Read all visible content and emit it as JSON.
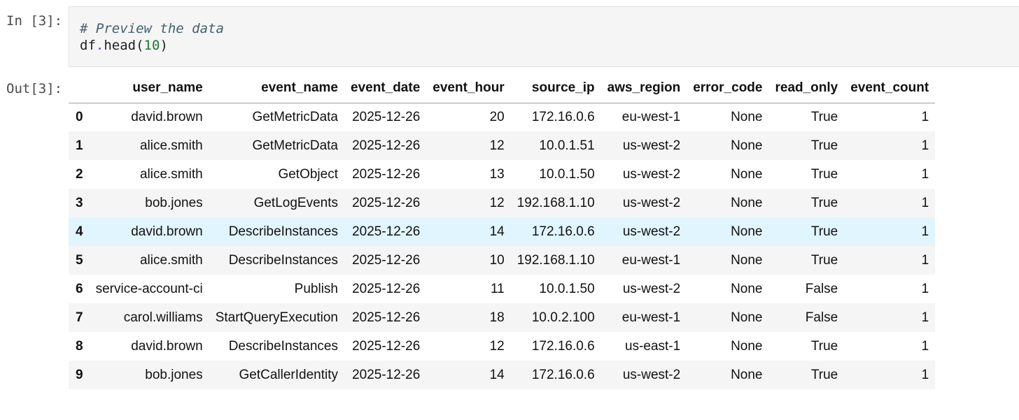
{
  "cell_input": {
    "prompt": "In [3]:",
    "comment": "# Preview the data",
    "code_obj": "df",
    "code_dot": ".",
    "code_method": "head(",
    "code_arg": "10",
    "code_close": ")"
  },
  "cell_output": {
    "prompt": "Out[3]:"
  },
  "table": {
    "columns": [
      "",
      "user_name",
      "event_name",
      "event_date",
      "event_hour",
      "source_ip",
      "aws_region",
      "error_code",
      "read_only",
      "event_count"
    ],
    "rows": [
      [
        "0",
        "david.brown",
        "GetMetricData",
        "2025-12-26",
        "20",
        "172.16.0.6",
        "eu-west-1",
        "None",
        "True",
        "1"
      ],
      [
        "1",
        "alice.smith",
        "GetMetricData",
        "2025-12-26",
        "12",
        "10.0.1.51",
        "us-west-2",
        "None",
        "True",
        "1"
      ],
      [
        "2",
        "alice.smith",
        "GetObject",
        "2025-12-26",
        "13",
        "10.0.1.50",
        "us-west-2",
        "None",
        "True",
        "1"
      ],
      [
        "3",
        "bob.jones",
        "GetLogEvents",
        "2025-12-26",
        "12",
        "192.168.1.10",
        "us-west-2",
        "None",
        "True",
        "1"
      ],
      [
        "4",
        "david.brown",
        "DescribeInstances",
        "2025-12-26",
        "14",
        "172.16.0.6",
        "us-west-2",
        "None",
        "True",
        "1"
      ],
      [
        "5",
        "alice.smith",
        "DescribeInstances",
        "2025-12-26",
        "10",
        "192.168.1.10",
        "eu-west-1",
        "None",
        "True",
        "1"
      ],
      [
        "6",
        "service-account-ci",
        "Publish",
        "2025-12-26",
        "11",
        "10.0.1.50",
        "us-west-2",
        "None",
        "False",
        "1"
      ],
      [
        "7",
        "carol.williams",
        "StartQueryExecution",
        "2025-12-26",
        "18",
        "10.0.2.100",
        "eu-west-1",
        "None",
        "False",
        "1"
      ],
      [
        "8",
        "david.brown",
        "DescribeInstances",
        "2025-12-26",
        "12",
        "172.16.0.6",
        "us-east-1",
        "None",
        "True",
        "1"
      ],
      [
        "9",
        "bob.jones",
        "GetCallerIdentity",
        "2025-12-26",
        "14",
        "172.16.0.6",
        "us-west-2",
        "None",
        "True",
        "1"
      ]
    ],
    "hovered_row_index": 4
  },
  "colors": {
    "code_bg": "#f5f5f5",
    "striped_row": "#f5f5f5",
    "hover_row": "#e1f5fe"
  }
}
